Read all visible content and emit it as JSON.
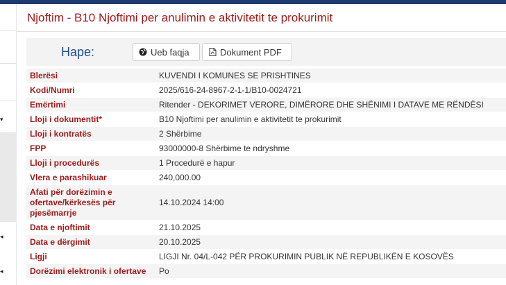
{
  "page": {
    "title": "Njoftim - B10 Njoftimi per anulimin e aktivitetit te prokurimit"
  },
  "actions": {
    "label": "Hape:",
    "web_button": "Ueb faqja",
    "web_icon": "globe-icon",
    "pdf_button": "Dokument PDF",
    "pdf_icon": "pdf-file-icon"
  },
  "details": [
    {
      "label": "Blerësi",
      "value": "KUVENDI I KOMUNES SE PRISHTINES"
    },
    {
      "label": "Kodi/Numri",
      "value": "2025/616-24-8967-2-1-1/B10-0024721"
    },
    {
      "label": "Emërtimi",
      "value": "Ritender - DEKORIMET VERORE, DIMËRORE DHE SHËNIMI I DATAVE ME RËNDËSI"
    },
    {
      "label": "Lloji i dokumentit*",
      "value": "B10 Njoftimi per anulimin e aktivitetit te prokurimit"
    },
    {
      "label": "Lloji i kontratës",
      "value": "2 Shërbime"
    },
    {
      "label": "FPP",
      "value": "93000000-8 Shërbime te ndryshme"
    },
    {
      "label": "Lloji i procedurës",
      "value": "1 Procedurë e hapur"
    },
    {
      "label": "Vlera e parashikuar",
      "value": "240,000.00"
    },
    {
      "label": "Afati për dorëzimin e ofertave/kërkesës për pjesëmarrje",
      "value": "14.10.2024 14:00"
    },
    {
      "label": "Data e njoftimit",
      "value": "21.10.2025"
    },
    {
      "label": "Data e dërgimit",
      "value": "20.10.2025"
    },
    {
      "label": "Ligji",
      "value": "LIGJI Nr. 04/L-042 PËR PROKURIMIN PUBLIK NË REPUBLIKËN E KOSOVËS"
    },
    {
      "label": "Dorëzimi elektronik i ofertave",
      "value": "Po"
    }
  ],
  "colors": {
    "label": "#9b1c1c",
    "hape": "#1f4f8a",
    "topbar": "#1f3a6e"
  }
}
